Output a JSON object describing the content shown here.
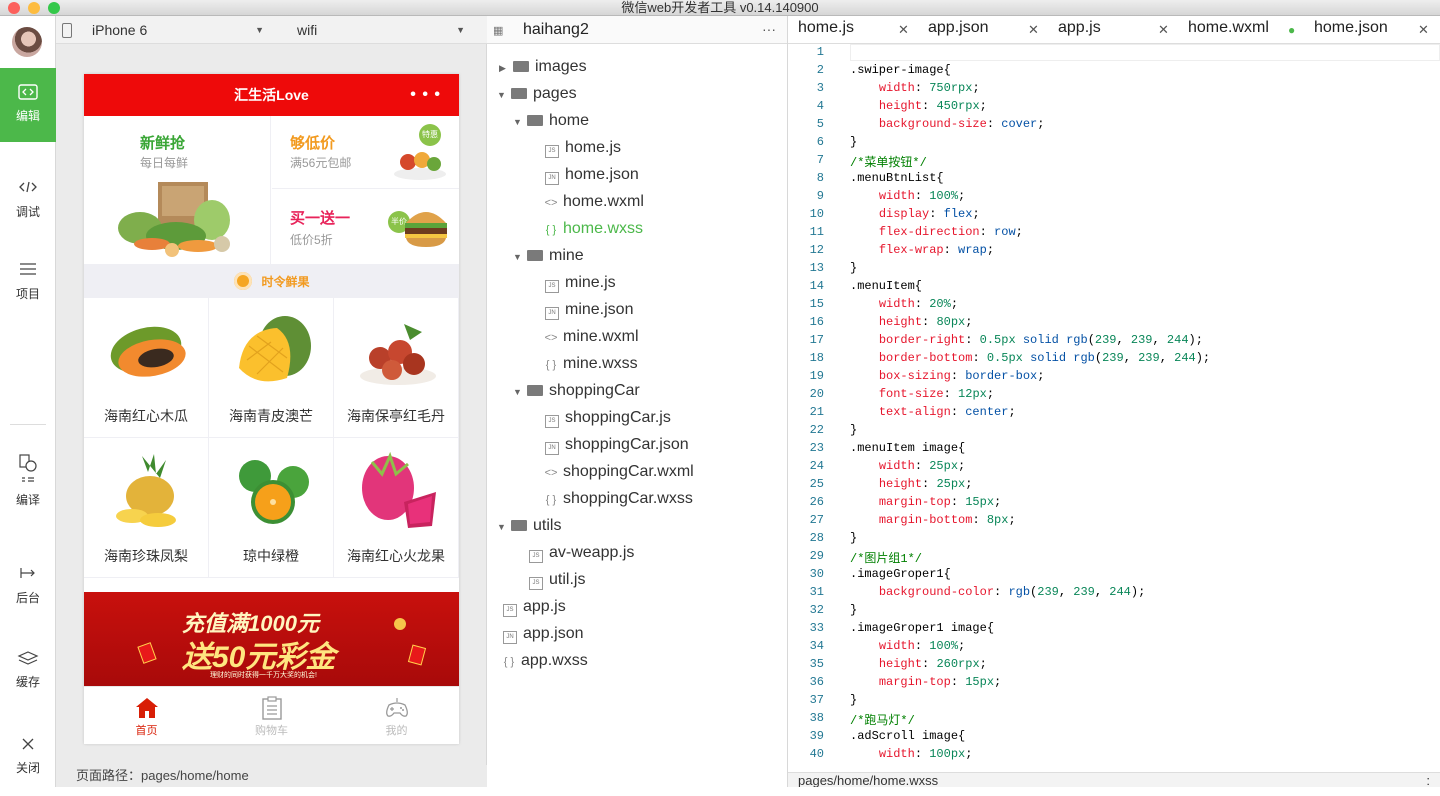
{
  "window": {
    "title": "微信web开发者工具 v0.14.140900"
  },
  "sidebar": {
    "items": [
      {
        "label": "编辑",
        "icon": "code-icon"
      },
      {
        "label": "调试",
        "icon": "debug-icon"
      },
      {
        "label": "项目",
        "icon": "menu-icon"
      },
      {
        "label": "编译",
        "icon": "compile-icon"
      },
      {
        "label": "后台",
        "icon": "background-icon"
      },
      {
        "label": "缓存",
        "icon": "layers-icon"
      },
      {
        "label": "关闭",
        "icon": "close-icon"
      }
    ]
  },
  "simulator": {
    "device": "iPhone 6",
    "network": "wifi",
    "page_path": "页面路径：pages/home/home",
    "nav_title": "汇生活Love",
    "nav_more": "• • •",
    "promo": {
      "fresh_title": "新鲜抢",
      "fresh_sub": "每日每鲜",
      "cheap_title": "够低价",
      "cheap_sub": "满56元包邮",
      "cheap_badge": "特惠",
      "bogo_title": "买一送一",
      "bogo_sub": "低价5折",
      "bogo_badge": "半价"
    },
    "seasonal_label": "时令鲜果",
    "fruits": [
      "海南红心木瓜",
      "海南青皮澳芒",
      "海南保亭红毛丹",
      "海南珍珠凤梨",
      "琼中绿橙",
      "海南红心火龙果"
    ],
    "banner": {
      "line1": "充值满1000元",
      "line2": "送50元彩金",
      "small": "理财的同时获得一千万大奖的机会!"
    },
    "tabs": [
      {
        "label": "首页",
        "icon": "home-icon"
      },
      {
        "label": "购物车",
        "icon": "cart-icon"
      },
      {
        "label": "我的",
        "icon": "gamepad-icon"
      }
    ]
  },
  "filetree": {
    "project": "haihang2",
    "more": "···",
    "nodes": [
      "images",
      "pages",
      "home",
      "home.js",
      "home.json",
      "home.wxml",
      "home.wxss",
      "mine",
      "mine.js",
      "mine.json",
      "mine.wxml",
      "mine.wxss",
      "shoppingCar",
      "shoppingCar.js",
      "shoppingCar.json",
      "shoppingCar.wxml",
      "shoppingCar.wxss",
      "utils",
      "av-weapp.js",
      "util.js",
      "app.js",
      "app.json",
      "app.wxss"
    ]
  },
  "editor": {
    "tabs": [
      "home.js",
      "app.json",
      "app.js",
      "home.wxml",
      "home.json"
    ],
    "status_path": "pages/home/home.wxss",
    "status_right": ":",
    "lines": [
      "",
      ".swiper-image{",
      "    width: 750rpx;",
      "    height: 450rpx;",
      "    background-size: cover;",
      "}",
      "/*菜单按钮*/",
      ".menuBtnList{",
      "    width: 100%;",
      "    display: flex;",
      "    flex-direction: row;",
      "    flex-wrap: wrap;",
      "}",
      ".menuItem{",
      "    width: 20%;",
      "    height: 80px;",
      "    border-right: 0.5px solid rgb(239, 239, 244);",
      "    border-bottom: 0.5px solid rgb(239, 239, 244);",
      "    box-sizing: border-box;",
      "    font-size: 12px;",
      "    text-align: center;",
      "}",
      ".menuItem image{",
      "    width: 25px;",
      "    height: 25px;",
      "    margin-top: 15px;",
      "    margin-bottom: 8px;",
      "}",
      "/*图片组1*/",
      ".imageGroper1{",
      "    background-color: rgb(239, 239, 244);",
      "}",
      ".imageGroper1 image{",
      "    width: 100%;",
      "    height: 260rpx;",
      "    margin-top: 15px;",
      "}",
      "/*跑马灯*/",
      ".adScroll image{",
      "    width: 100px;"
    ]
  }
}
